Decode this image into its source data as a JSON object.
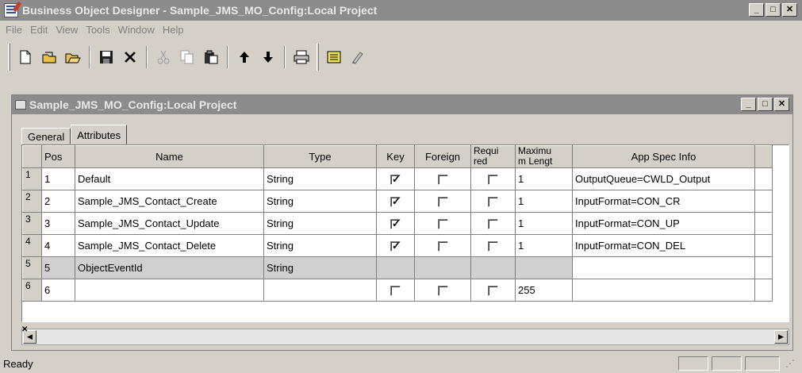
{
  "app": {
    "title": "Business Object Designer - Sample_JMS_MO_Config:Local Project"
  },
  "menu": [
    "File",
    "Edit",
    "View",
    "Tools",
    "Window",
    "Help"
  ],
  "toolbar_icons": [
    "new-icon",
    "open-icon",
    "open-folder-icon",
    "save-icon",
    "delete-icon",
    "cut-icon",
    "copy-icon",
    "paste-icon",
    "move-up-icon",
    "move-down-icon",
    "print-icon",
    "properties-icon",
    "edit-icon"
  ],
  "doc": {
    "title": "Sample_JMS_MO_Config:Local Project",
    "tabs": [
      "General",
      "Attributes"
    ],
    "active_tab": "Attributes"
  },
  "table": {
    "headers": [
      "Pos",
      "Name",
      "Type",
      "Key",
      "Foreign",
      "Required",
      "Maximum Length",
      "App Spec Info"
    ],
    "header_display": [
      "Pos",
      "Name",
      "Type",
      "Key",
      "Foreign",
      "Requi\nred",
      "Maximu\nm Lengt",
      "App Spec Info"
    ],
    "rows": [
      {
        "row": "1",
        "pos": "1",
        "name": "Default",
        "type": "String",
        "key": true,
        "foreign": false,
        "required": false,
        "max": "1",
        "app": "OutputQueue=CWLD_Output",
        "greyed": false
      },
      {
        "row": "2",
        "pos": "2",
        "name": "Sample_JMS_Contact_Create",
        "type": "String",
        "key": true,
        "foreign": false,
        "required": false,
        "max": "1",
        "app": "InputFormat=CON_CR",
        "greyed": false
      },
      {
        "row": "3",
        "pos": "3",
        "name": "Sample_JMS_Contact_Update",
        "type": "String",
        "key": true,
        "foreign": false,
        "required": false,
        "max": "1",
        "app": "InputFormat=CON_UP",
        "greyed": false
      },
      {
        "row": "4",
        "pos": "4",
        "name": "Sample_JMS_Contact_Delete",
        "type": "String",
        "key": true,
        "foreign": false,
        "required": false,
        "max": "1",
        "app": "InputFormat=CON_DEL",
        "greyed": false
      },
      {
        "row": "5",
        "pos": "5",
        "name": "ObjectEventId",
        "type": "String",
        "key": null,
        "foreign": null,
        "required": null,
        "max": "",
        "app": "",
        "greyed": true
      },
      {
        "row": "6",
        "pos": "6",
        "name": "",
        "type": "",
        "key": false,
        "foreign": false,
        "required": false,
        "max": "255",
        "app": "",
        "greyed": false
      }
    ]
  },
  "status": {
    "text": "Ready"
  }
}
